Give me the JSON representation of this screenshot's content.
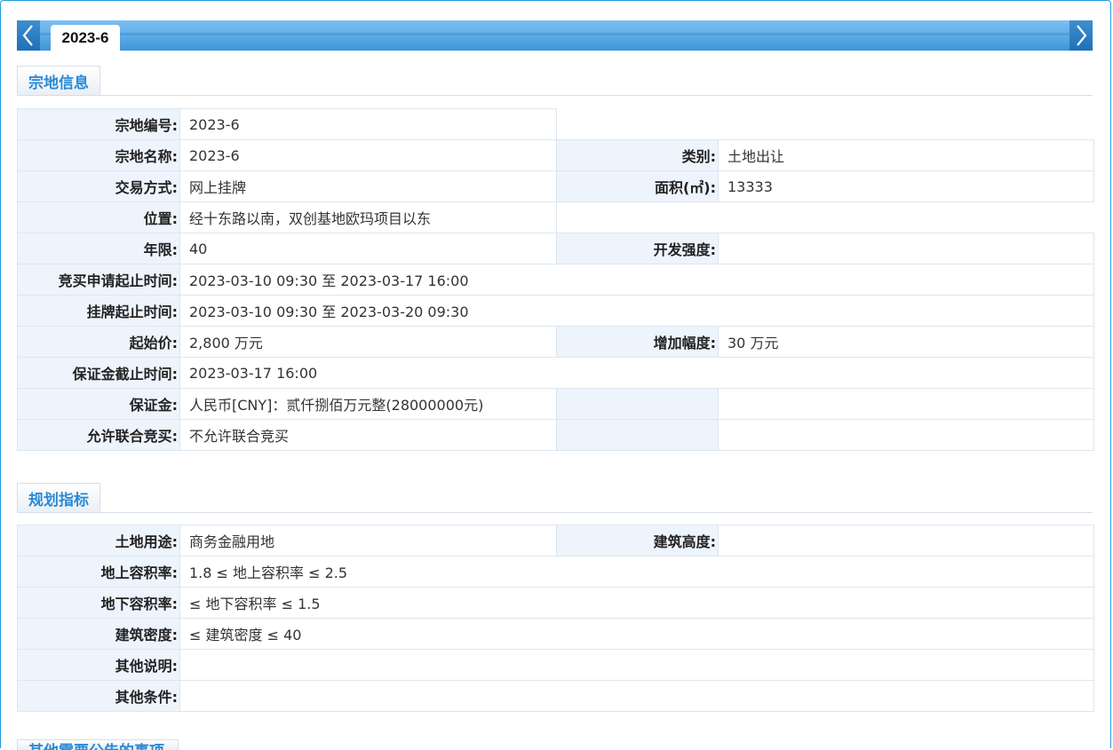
{
  "tab": {
    "label": "2023-6"
  },
  "sections": {
    "parcel_info": "宗地信息",
    "planning": "规划指标",
    "other": "其他需要公告的事项"
  },
  "parcel": {
    "rows": [
      {
        "l1": "宗地编号:",
        "v1": "2023-6",
        "l2": "",
        "v2": ""
      },
      {
        "l1": "宗地名称:",
        "v1": "2023-6",
        "l2": "类别:",
        "v2": "土地出让"
      },
      {
        "l1": "交易方式:",
        "v1": "网上挂牌",
        "l2": "面积(㎡):",
        "v2": "13333"
      },
      {
        "l1": "位置:",
        "v1": "经十东路以南，双创基地欧玛项目以东",
        "l2": "",
        "v2": ""
      },
      {
        "l1": "年限:",
        "v1": "40",
        "l2": "开发强度:",
        "v2": ""
      },
      {
        "l1": "竞买申请起止时间:",
        "v1": "2023-03-10 09:30 至 2023-03-17 16:00"
      },
      {
        "l1": "挂牌起止时间:",
        "v1": "2023-03-10 09:30 至 2023-03-20 09:30"
      },
      {
        "l1": "起始价:",
        "v1": "2,800 万元",
        "l2": "增加幅度:",
        "v2": "30 万元"
      },
      {
        "l1": "保证金截止时间:",
        "v1": "2023-03-17 16:00"
      },
      {
        "l1": "保证金:",
        "v1": "人民币[CNY]：贰仟捌佰万元整(28000000元)",
        "l2": "",
        "v2": ""
      },
      {
        "l1": "允许联合竞买:",
        "v1": "不允许联合竞买",
        "l2": "",
        "v2": ""
      }
    ]
  },
  "planning": {
    "rows": [
      {
        "l1": "土地用途:",
        "v1": "商务金融用地",
        "l2": "建筑高度:",
        "v2": ""
      },
      {
        "l1": "地上容积率:",
        "v1": "1.8 ≤ 地上容积率 ≤ 2.5"
      },
      {
        "l1": "地下容积率:",
        "v1": "≤ 地下容积率 ≤ 1.5"
      },
      {
        "l1": "建筑密度:",
        "v1": "≤ 建筑密度 ≤ 40"
      },
      {
        "l1": "其他说明:",
        "v1": ""
      },
      {
        "l1": "其他条件:",
        "v1": ""
      }
    ]
  }
}
